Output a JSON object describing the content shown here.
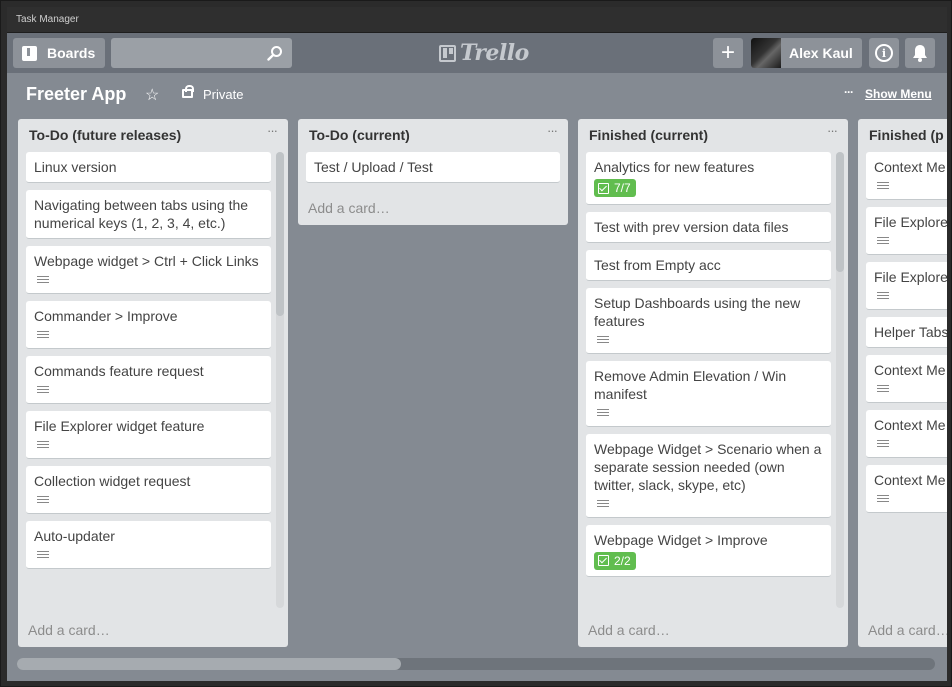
{
  "window": {
    "title": "Task Manager"
  },
  "header": {
    "boards_label": "Boards",
    "search_placeholder": "",
    "logo_text": "Trello",
    "add_label": "+",
    "user_name": "Alex Kaul",
    "info_label": "i"
  },
  "board": {
    "title": "Freeter App",
    "visibility": "Private",
    "menu_dots": "···",
    "show_menu": "Show Menu"
  },
  "lists": [
    {
      "title": "To-Do (future releases)",
      "menu": "···",
      "add_card": "Add a card…",
      "cards": [
        {
          "text": "Linux version",
          "desc": false
        },
        {
          "text": "Navigating between tabs using the numerical keys (1, 2, 3, 4, etc.)",
          "desc": false
        },
        {
          "text": "Webpage widget > Ctrl + Click Links",
          "desc": true
        },
        {
          "text": "Commander > Improve",
          "desc": true
        },
        {
          "text": "Commands feature request",
          "desc": true
        },
        {
          "text": "File Explorer widget feature",
          "desc": true
        },
        {
          "text": "Collection widget request",
          "desc": true
        },
        {
          "text": "Auto-updater",
          "desc": true
        }
      ]
    },
    {
      "title": "To-Do (current)",
      "menu": "···",
      "add_card": "Add a card…",
      "cards": [
        {
          "text": "Test / Upload / Test",
          "desc": false
        }
      ]
    },
    {
      "title": "Finished (current)",
      "menu": "···",
      "add_card": "Add a card…",
      "cards": [
        {
          "text": "Analytics for new features",
          "desc": false,
          "checklist": "7/7"
        },
        {
          "text": "Test with prev version data files",
          "desc": false
        },
        {
          "text": "Test from Empty acc",
          "desc": false
        },
        {
          "text": "Setup Dashboards using the new features",
          "desc": true
        },
        {
          "text": "Remove Admin Elevation / Win manifest",
          "desc": true
        },
        {
          "text": "Webpage Widget > Scenario when a separate session needed (own twitter, slack, skype, etc)",
          "desc": true
        },
        {
          "text": "Webpage Widget > Improve",
          "desc": false,
          "checklist": "2/2"
        }
      ]
    },
    {
      "title": "Finished (p",
      "add_card": "Add a card…",
      "cards": [
        {
          "text": "Context Me widget",
          "desc": true
        },
        {
          "text": "File Explore",
          "desc": true
        },
        {
          "text": "File Explore",
          "desc": true
        },
        {
          "text": "Helper Tabs Show/Hide",
          "desc": false
        },
        {
          "text": "Context Me",
          "desc": true
        },
        {
          "text": "Context Me",
          "desc": true
        },
        {
          "text": "Context Me",
          "desc": true
        }
      ]
    }
  ],
  "colors": {
    "header_bg": "#6a7079",
    "board_bg": "#848a92",
    "list_bg": "#e2e4e6",
    "checklist_green": "#61bd4f"
  }
}
